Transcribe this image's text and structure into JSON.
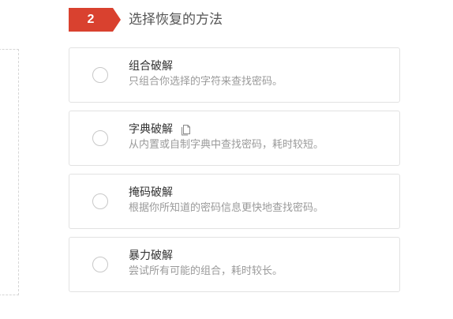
{
  "step": {
    "number": "2",
    "title": "选择恢复的方法",
    "badge_color": "#d9412f"
  },
  "options": [
    {
      "title": "组合破解",
      "description": "只组合你选择的字符来查找密码。",
      "icon": null
    },
    {
      "title": "字典破解",
      "description": "从内置或自制字典中查找密码，耗时较短。",
      "icon": "document-icon"
    },
    {
      "title": "掩码破解",
      "description": "根据你所知道的密码信息更快地查找密码。",
      "icon": null
    },
    {
      "title": "暴力破解",
      "description": "尝试所有可能的组合，耗时较长。",
      "icon": null
    }
  ]
}
